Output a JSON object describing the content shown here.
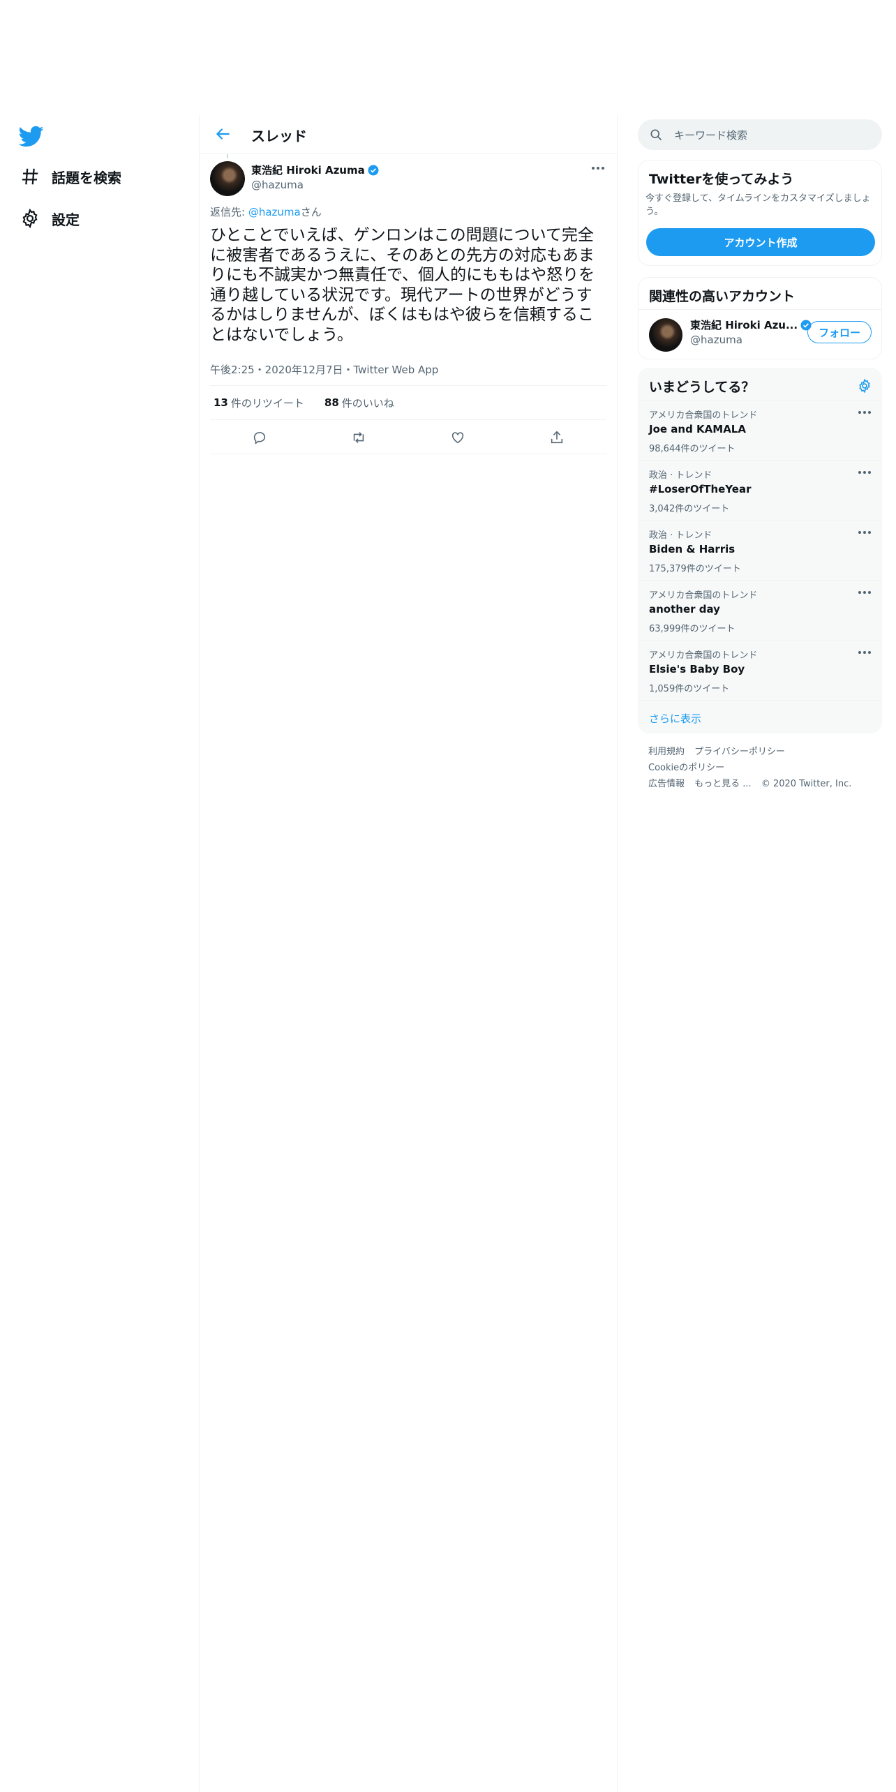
{
  "nav": {
    "items": [
      {
        "label": "話題を検索",
        "icon": "hashtag-icon"
      },
      {
        "label": "設定",
        "icon": "gear-icon"
      }
    ]
  },
  "header": {
    "title": "スレッド"
  },
  "tweet": {
    "author_name": "東浩紀 Hiroki Azuma",
    "author_handle": "@hazuma",
    "reply_prefix": "返信先: ",
    "reply_handle": "@hazuma",
    "reply_suffix": "さん",
    "text": "ひとことでいえば、ゲンロンはこの問題について完全に被害者であるうえに、そのあとの先方の対応もあまりにも不誠実かつ無責任で、個人的にももはや怒りを通り越している状況です。現代アートの世界がどうするかはしりませんが、ぼくはもはや彼らを信頼することはないでしょう。",
    "meta": "午後2:25・2020年12月7日・Twitter Web App",
    "retweets": "13",
    "retweets_label": "件のリツイート",
    "likes": "88",
    "likes_label": "件のいいね"
  },
  "search": {
    "placeholder": "キーワード検索"
  },
  "signup": {
    "title": "Twitterを使ってみよう",
    "desc": "今すぐ登録して、タイムラインをカスタマイズしましょう。",
    "button": "アカウント作成"
  },
  "related": {
    "title": "関連性の高いアカウント",
    "name": "東浩紀 Hiroki Azu...",
    "handle": "@hazuma",
    "follow": "フォロー"
  },
  "trends": {
    "title": "いまどうしてる？",
    "items": [
      {
        "context": "アメリカ合衆国のトレンド",
        "name": "Joe and KAMALA",
        "count": "98,644件のツイート"
      },
      {
        "context": "政治 · トレンド",
        "name": "#LoserOfTheYear",
        "count": "3,042件のツイート"
      },
      {
        "context": "政治 · トレンド",
        "name": "Biden & Harris",
        "count": "175,379件のツイート"
      },
      {
        "context": "アメリカ合衆国のトレンド",
        "name": "another day",
        "count": "63,999件のツイート"
      },
      {
        "context": "アメリカ合衆国のトレンド",
        "name": "Elsie's Baby Boy",
        "count": "1,059件のツイート"
      }
    ],
    "show_more": "さらに表示"
  },
  "footer": {
    "links": [
      "利用規約",
      "プライバシーポリシー",
      "Cookieのポリシー",
      "広告情報",
      "もっと見る ..."
    ],
    "copyright": "© 2020 Twitter, Inc."
  },
  "colors": {
    "accent": "#1d9bf0",
    "text": "#0f1419",
    "muted": "#536471",
    "border": "#eff3f4"
  }
}
